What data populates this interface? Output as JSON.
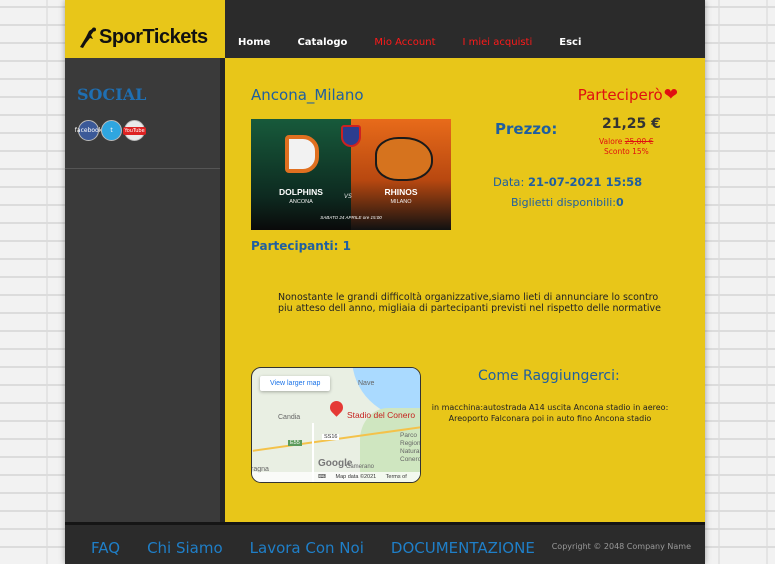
{
  "header": {
    "logo_text": "SporTickets",
    "nav": [
      {
        "label": "Home",
        "highlight": false
      },
      {
        "label": "Catalogo",
        "highlight": false
      },
      {
        "label": "Mio Account",
        "highlight": true
      },
      {
        "label": "I miei acquisti",
        "highlight": true
      },
      {
        "label": "Esci",
        "highlight": false
      }
    ]
  },
  "sidebar": {
    "title": "SOCIAL",
    "icons": [
      {
        "name": "facebook-icon",
        "label": "facebook"
      },
      {
        "name": "twitter-icon",
        "label": "t"
      },
      {
        "name": "youtube-icon",
        "label": "YouTube"
      }
    ]
  },
  "event": {
    "title": "Ancona_Milano",
    "partecipero_label": "Parteciperò",
    "poster": {
      "team1": "DOLPHINS",
      "city1": "ANCONA",
      "vs": "VS",
      "team2": "RHINOS",
      "city2": "MILANO",
      "date_line": "SABATO 24 APRILE ore 15:00"
    },
    "partecipanti_label": "Partecipanti:",
    "partecipanti_count": "1",
    "prezzo_label": "Prezzo:",
    "price": "21,25 €",
    "valore_label": "Valore",
    "valore_original": "25,00 €",
    "sconto": "Sconto 15%",
    "data_label": "Data:",
    "data_value": "21-07-2021 15:58",
    "biglietti_label": "Biglietti disponibili:",
    "biglietti_value": "0",
    "description": "Nonostante le grandi difficoltà organizzative,siamo lieti di annunciare lo scontro piu atteso dell anno, migliaia di partecipanti previsti nel rispetto delle normative"
  },
  "map": {
    "larger_map_label": "View larger map",
    "poi_label": "Stadio del Conero",
    "labels": [
      "Nave",
      "Candia",
      "Parco Regionale Naturale Conero",
      "E55",
      "SS16",
      "ragna",
      "Camerano"
    ],
    "google_label": "Google",
    "map_data": "Map data ©2021",
    "terms": "Terms of Use"
  },
  "directions": {
    "title": "Come Raggiungerci:",
    "text": "in macchina:autostrada A14 uscita Ancona stadio in aereo: Areoporto Falconara poi in auto fino Ancona stadio"
  },
  "footer": {
    "links": [
      "FAQ",
      "Chi Siamo",
      "Lavora Con Noi",
      "DOCUMENTAZIONE"
    ],
    "copyright": "Copyright © 2048 Company Name"
  },
  "colors": {
    "accent_yellow": "#e8c619",
    "dark": "#2b2b2b",
    "link_blue": "#1f5fa0",
    "alert_red": "#e01010"
  }
}
